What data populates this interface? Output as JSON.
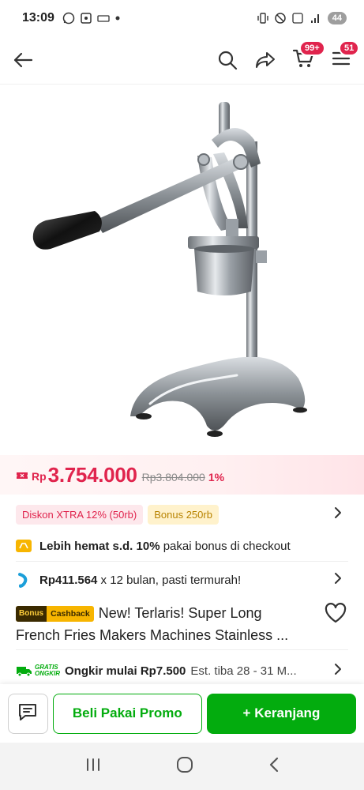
{
  "status_bar": {
    "time": "13:09",
    "battery": "44"
  },
  "app_bar": {
    "cart_badge": "99+",
    "menu_badge": "51"
  },
  "price": {
    "currency": "Rp",
    "current": "3.754.000",
    "original": "Rp3.804.000",
    "discount": "1%"
  },
  "chips": [
    {
      "label": "Diskon XTRA 12% (50rb)"
    },
    {
      "label": "Bonus 250rb"
    }
  ],
  "hemat": {
    "bold": "Lebih hemat s.d. 10%",
    "rest": " pakai bonus di checkout"
  },
  "cicilan": {
    "amount": "Rp411.564",
    "rest": " x 12 bulan, pasti termurah!"
  },
  "product": {
    "badge_left": "Bonus",
    "badge_right": "Cashback",
    "title_line1": "New! Terlaris! Super Long",
    "title_line2": "French Fries Makers Machines Stainless ..."
  },
  "shipping": {
    "logo_line1": "GRATIS",
    "logo_line2": "ONGKIR",
    "label": "Ongkir mulai Rp7.500",
    "estimate": "Est. tiba 28 - 31 M..."
  },
  "actions": {
    "promo_label": "Beli Pakai Promo",
    "cart_label": "+ Keranjang"
  },
  "colors": {
    "brand_green": "#03ac0e",
    "price_red": "#e0244d",
    "badge_yellow": "#f7b500"
  },
  "icons": [
    "back-arrow-icon",
    "search-icon",
    "share-icon",
    "cart-icon",
    "menu-icon",
    "wishlist-heart-icon",
    "chat-icon",
    "chevron-right-icon"
  ]
}
